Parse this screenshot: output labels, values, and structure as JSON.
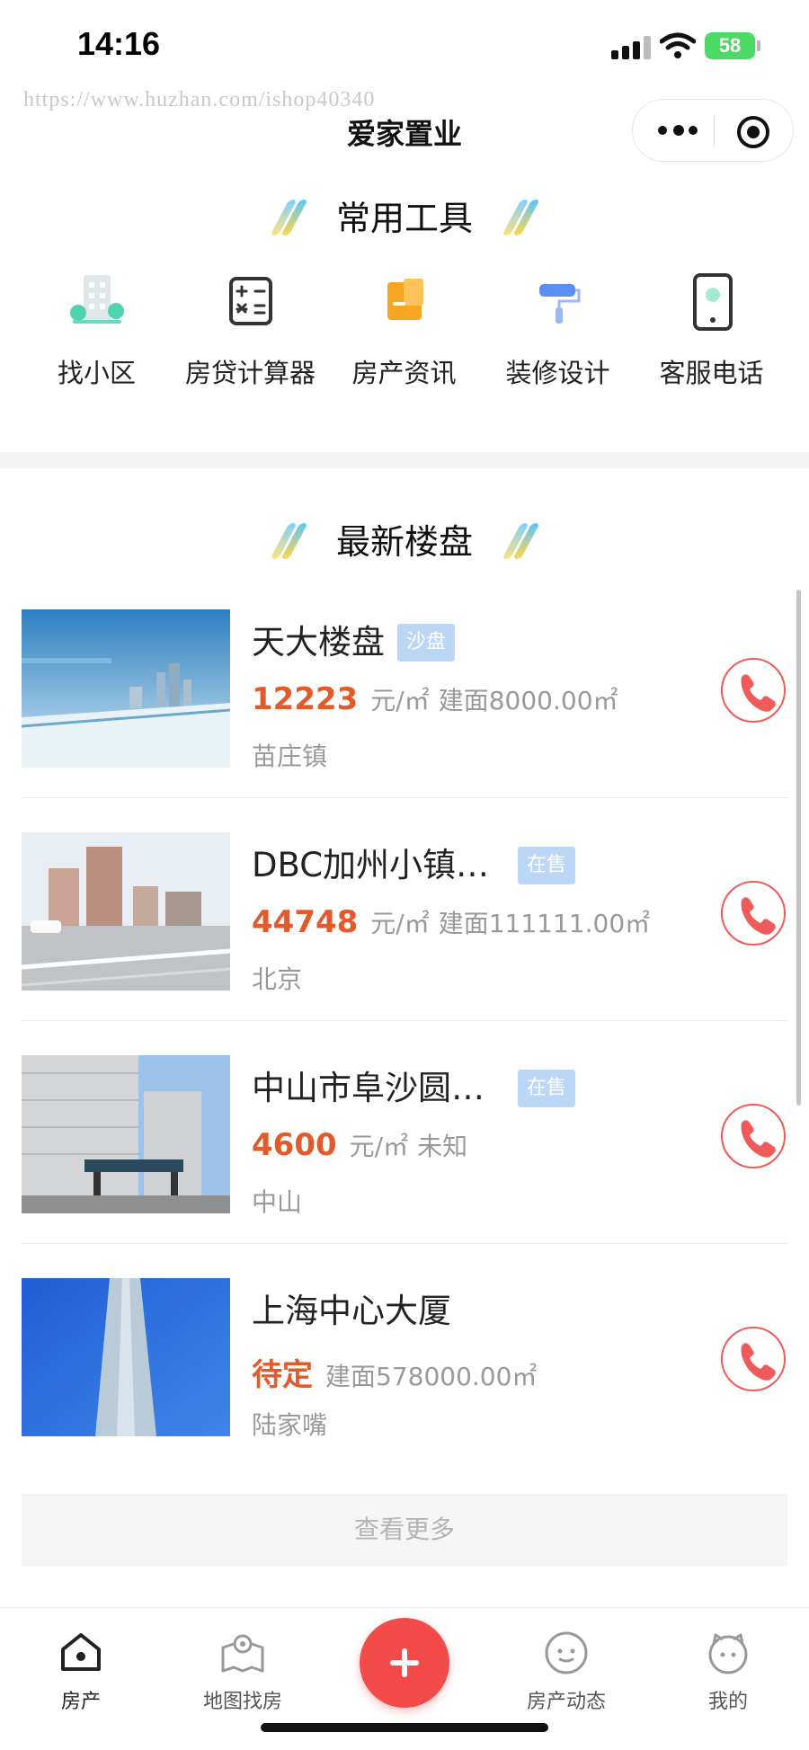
{
  "status_bar": {
    "time": "14:16",
    "battery": "58"
  },
  "watermark": "https://www.huzhan.com/ishop40340",
  "nav": {
    "title": "爱家置业"
  },
  "tools_section": {
    "title": "常用工具",
    "items": [
      {
        "label": "找小区",
        "icon": "building-icon"
      },
      {
        "label": "房贷计算器",
        "icon": "calculator-icon"
      },
      {
        "label": "房产资讯",
        "icon": "news-icon"
      },
      {
        "label": "装修设计",
        "icon": "paint-roller-icon"
      },
      {
        "label": "客服电话",
        "icon": "phone-device-icon"
      }
    ]
  },
  "listings_section": {
    "title": "最新楼盘",
    "items": [
      {
        "name": "天大楼盘",
        "badge": "沙盘",
        "price": "12223",
        "unit": "元/㎡",
        "area": "建面8000.00㎡",
        "location": "苗庄镇"
      },
      {
        "name": "DBC加州小镇…",
        "badge": "在售",
        "price": "44748",
        "unit": "元/㎡",
        "area": "建面111111.00㎡",
        "location": "北京"
      },
      {
        "name": "中山市阜沙圆…",
        "badge": "在售",
        "price": "4600",
        "unit": "元/㎡",
        "area": "未知",
        "location": "中山"
      },
      {
        "name": "上海中心大厦",
        "badge": "",
        "price": "待定",
        "unit": "",
        "area": "建面578000.00㎡",
        "location": "陆家嘴"
      }
    ],
    "more_label": "查看更多"
  },
  "tabbar": {
    "items": [
      {
        "label": "房产",
        "icon": "home-icon"
      },
      {
        "label": "地图找房",
        "icon": "map-pin-icon"
      },
      {
        "label": "房产动态",
        "icon": "chat-face-icon"
      },
      {
        "label": "我的",
        "icon": "profile-face-icon"
      }
    ]
  },
  "colors": {
    "accent_red": "#f34a4a",
    "price_orange": "#e05a2b",
    "badge_blue": "#bcd6f6"
  }
}
